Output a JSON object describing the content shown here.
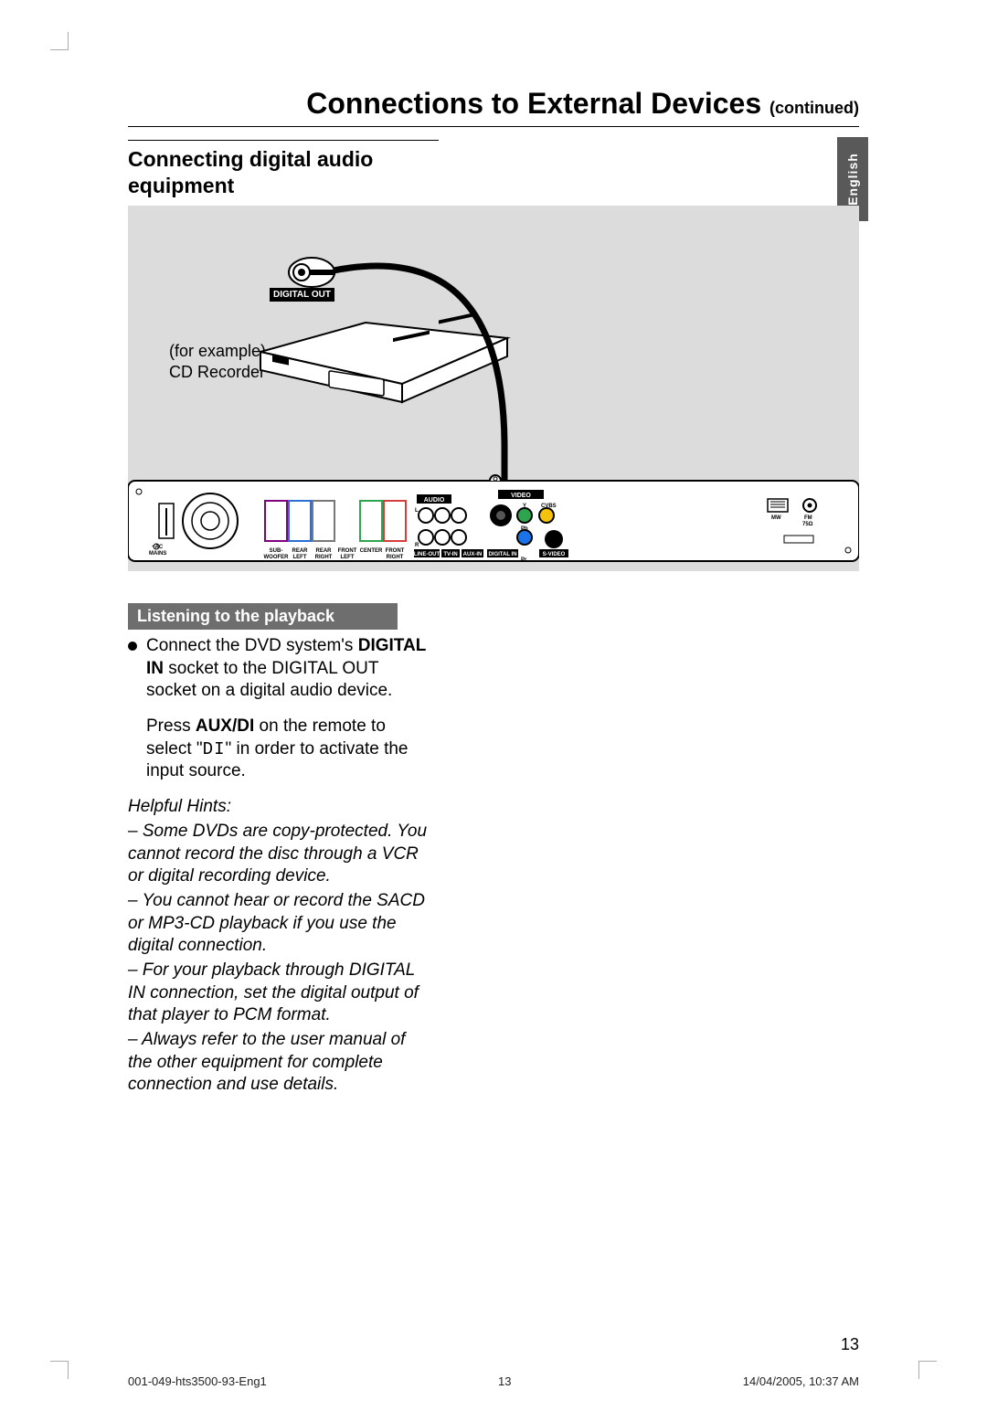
{
  "header": {
    "title_main": "Connections to External Devices",
    "title_cont": "(continued)"
  },
  "section": {
    "heading": "Connecting digital audio equipment"
  },
  "lang_tab": "English",
  "diagram": {
    "example_label_line1": "(for example)",
    "example_label_line2": "CD Recorder",
    "digital_out_label": "DIGITAL OUT",
    "panel_labels": {
      "audio": "AUDIO",
      "video": "VIDEO",
      "y": "Y",
      "cvbs": "CVBS",
      "pb": "Pb",
      "pr": "Pr",
      "svideo": "S-VIDEO",
      "mains": "~AC\nMAINS",
      "mw": "MW",
      "fm": "FM\n75Ω",
      "subwoofer": "SUB-\nWOOFER",
      "rear_left": "REAR\nLEFT",
      "rear_right": "REAR\nRIGHT",
      "front_left": "FRONT\nLEFT",
      "center": "CENTER",
      "front_right": "FRONT\nRIGHT",
      "line_out": "LINE-OUT",
      "tv_in": "TV-IN",
      "aux_in": "AUX-IN",
      "digital_in": "DIGITAL IN",
      "l": "L",
      "r": "R"
    }
  },
  "subhead": "Listening to the playback",
  "body": {
    "p1_a": "Connect the DVD system's ",
    "p1_b": "DIGITAL IN",
    "p1_c": " socket to the DIGITAL OUT socket on a digital audio device.",
    "p2_a": "Press ",
    "p2_b": "AUX/DI",
    "p2_c": " on the remote to select \"",
    "p2_d": "DI",
    "p2_e": "\" in order to activate the input source.",
    "hints_title": "Helpful Hints:",
    "hint1": "– Some DVDs are copy-protected. You cannot record the disc through a VCR or digital recording device.",
    "hint2": "– You cannot hear or record the SACD or MP3-CD playback if you use the digital connection.",
    "hint3": "– For your playback through DIGITAL IN connection, set the digital output of that player to PCM format.",
    "hint4": "– Always refer to the user manual of the other equipment for complete connection and use details."
  },
  "page_number": "13",
  "footer": {
    "doc_code": "001-049-hts3500-93-Eng1",
    "page": "13",
    "timestamp": "14/04/2005, 10:37 AM"
  }
}
